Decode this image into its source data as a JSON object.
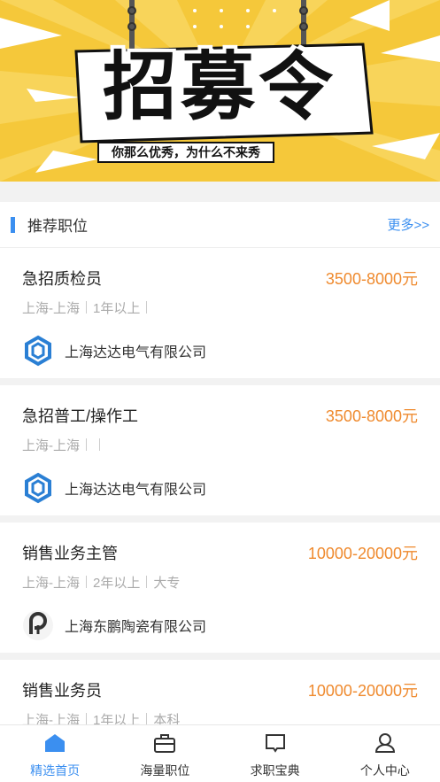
{
  "banner": {
    "title": "招募令",
    "subtitle": "你那么优秀，为什么不来秀"
  },
  "section": {
    "title": "推荐职位",
    "more": "更多>>"
  },
  "jobs": [
    {
      "title": "急招质检员",
      "salary": "3500-8000元",
      "location": "上海-上海",
      "experience": "1年以上",
      "education": "",
      "company": "上海达达电气有限公司",
      "logo": "hexagon-logo"
    },
    {
      "title": "急招普工/操作工",
      "salary": "3500-8000元",
      "location": "上海-上海",
      "experience": "",
      "education": "",
      "company": "上海达达电气有限公司",
      "logo": "hexagon-logo"
    },
    {
      "title": "销售业务主管",
      "salary": "10000-20000元",
      "location": "上海-上海",
      "experience": "2年以上",
      "education": "大专",
      "company": "上海东鹏陶瓷有限公司",
      "logo": "dongpeng-logo"
    },
    {
      "title": "销售业务员",
      "salary": "10000-20000元",
      "location": "上海-上海",
      "experience": "1年以上",
      "education": "本科",
      "company": "",
      "logo": ""
    }
  ],
  "tabs": [
    {
      "label": "精选首页",
      "icon": "home-icon",
      "active": true
    },
    {
      "label": "海量职位",
      "icon": "briefcase-icon",
      "active": false
    },
    {
      "label": "求职宝典",
      "icon": "book-icon",
      "active": false
    },
    {
      "label": "个人中心",
      "icon": "user-icon",
      "active": false
    }
  ],
  "colors": {
    "accent": "#3b8ff0",
    "salary": "#ef8a2e",
    "banner": "#f5c83a"
  }
}
